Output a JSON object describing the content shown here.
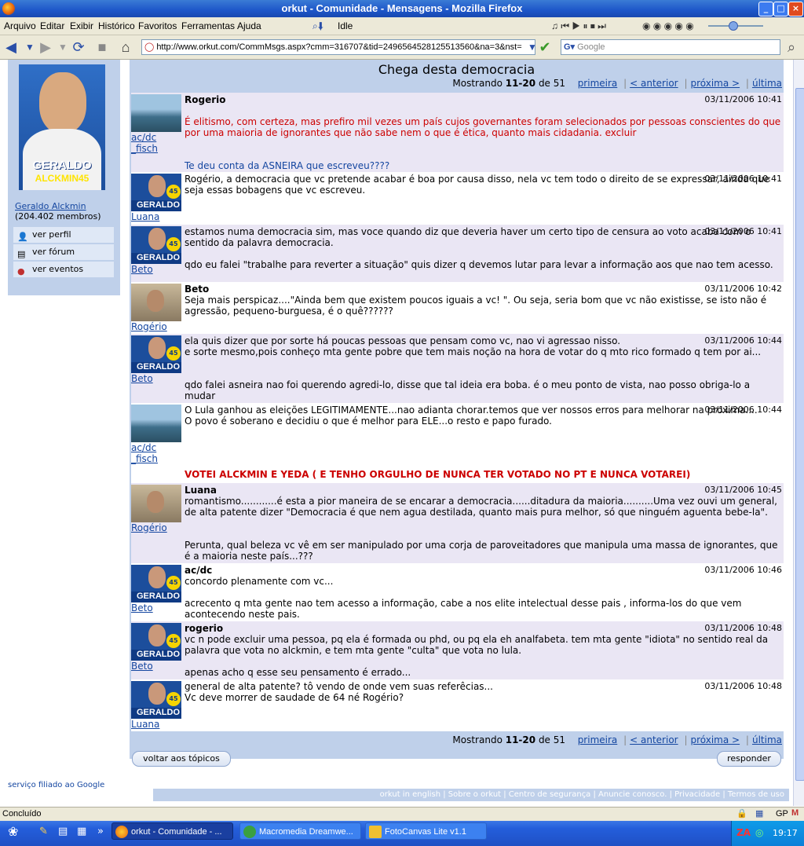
{
  "window": {
    "title": "orkut - Comunidade - Mensagens - Mozilla Firefox"
  },
  "menu": [
    "Arquivo",
    "Editar",
    "Exibir",
    "Histórico",
    "Favoritos",
    "Ferramentas",
    "Ajuda"
  ],
  "toolbar": {
    "idle_label": "Idle"
  },
  "address": {
    "url": "http://www.orkut.com/CommMsgs.aspx?cmm=316707&tid=2496564528125513560&na=3&nst=",
    "search_placeholder": "Google"
  },
  "left": {
    "profile_line1": "GERALDO",
    "profile_line2": "ALCKMIN45",
    "community_name": "Geraldo Alckmin",
    "members": "(204.402 membros)",
    "links": [
      {
        "label": "ver perfil"
      },
      {
        "label": "ver fórum"
      },
      {
        "label": "ver eventos"
      }
    ]
  },
  "topic": {
    "title": "Chega desta democracia",
    "pager": {
      "prefix": "Mostrando ",
      "range": "11-20",
      "of": " de 51",
      "first": "primeira",
      "prev": "< anterior",
      "next": "próxima >",
      "last": "última"
    }
  },
  "posts": [
    {
      "user": "ac/dc\n_fisch",
      "avatar": "sea",
      "author": "Rogerio",
      "date": "03/11/2006 10:41",
      "quote": "É elitismo, com certeza, mas prefiro mil vezes um país cujos governantes foram selecionados por pessoas conscientes do que por uma maioria de ignorantes que não sabe nem o que é ética, quanto mais cidadania. excluir",
      "text": "Te deu conta da ASNEIRA que escreveu????"
    },
    {
      "user": "Luana",
      "avatar": "gera",
      "author": "",
      "date": "03/11/2006 10:41",
      "text": "Rogério, a democracia que vc pretende acabar é boa por causa disso, nela vc tem todo o direito de se expressar, ainda que seja essas bobagens que vc escreveu."
    },
    {
      "user": "Beto",
      "avatar": "gera",
      "author": "",
      "date": "03/11/2006 10:41",
      "text": "estamos numa democracia sim, mas voce quando diz que deveria haver um certo tipo de censura ao voto acaba com o sentido da palavra democracia.",
      "text2": "qdo eu falei \"trabalhe para reverter a situação\" quis dizer q devemos lutar para levar a informação aos que nao tem acesso."
    },
    {
      "user": "Rogério",
      "avatar": "room",
      "author": "Beto",
      "date": "03/11/2006 10:42",
      "text": "Seja mais perspicaz....\"Ainda bem que existem poucos iguais a vc! \". Ou seja, seria bom que vc não existisse, se isto não é agressão, pequeno-burguesa, é o quê??????"
    },
    {
      "user": "Beto",
      "avatar": "gera",
      "author": "",
      "date": "03/11/2006 10:44",
      "text": "ela quis dizer que por sorte há poucas pessoas que pensam como vc, nao vi agressao nisso.\ne sorte mesmo,pois conheço mta gente pobre que tem mais noção na hora de votar do q mto rico formado q tem por ai...",
      "text2": "qdo falei asneira nao foi querendo agredi-lo, disse que tal ideia era boba. é o meu ponto de vista, nao posso obriga-lo a mudar"
    },
    {
      "user": "ac/dc\n_fisch",
      "avatar": "sea",
      "author": "",
      "date": "03/11/2006 10:44",
      "text": "O Lula ganhou as eleições LEGITIMAMENTE...nao adianta chorar.temos que ver nossos erros para melhorar na proxima....\nO povo é soberano e decidiu o que é melhor para ELE...o resto e papo furado.",
      "sig": "VOTEI ALCKMIN E YEDA ( E TENHO ORGULHO DE NUNCA TER VOTADO NO PT E NUNCA VOTAREI)"
    },
    {
      "user": "Rogério",
      "avatar": "room",
      "author": "Luana",
      "date": "03/11/2006 10:45",
      "text": "romantismo............é esta a pior maneira de se encarar a democracia......ditadura da maioria..........Uma vez ouvi um general, de alta patente dizer \"Democracia é que nem agua destilada, quanto mais pura melhor, só que ninguém aguenta bebe-la\".",
      "text2": "Perunta, qual beleza vc vê em ser manipulado por uma corja de paroveitadores que manipula uma massa de ignorantes, que é a maioria neste país...???"
    },
    {
      "user": "Beto",
      "avatar": "gera",
      "author": "ac/dc",
      "date": "03/11/2006 10:46",
      "text": "concordo plenamente com vc...",
      "text2": "acrecento q mta gente nao tem acesso a informação, cabe a nos elite intelectual desse pais , informa-los do que vem acontecendo neste pais."
    },
    {
      "user": "Beto",
      "avatar": "gera",
      "author": "rogerio",
      "date": "03/11/2006 10:48",
      "text": "vc n pode excluir uma pessoa, pq ela é formada ou phd, ou pq ela eh analfabeta. tem mta gente \"idiota\" no sentido real da palavra que vota no alckmin, e tem mta gente \"culta\" que vota no lula.",
      "text2": "apenas acho q esse seu pensamento é errado..."
    },
    {
      "user": "Luana",
      "avatar": "gera",
      "author": "",
      "date": "03/11/2006 10:48",
      "text": "general de alta patente? tô vendo de onde vem suas referêcias...\nVc deve morrer de saudade de 64 né Rogério?"
    }
  ],
  "buttons": {
    "back_topics": "voltar aos tópicos",
    "reply": "responder"
  },
  "footer": {
    "filiado": "serviço filiado ao Google",
    "links": "orkut in english  |  Sobre o orkut | Centro de segurança | Anuncie conosco. | Privacidade | Termos de uso"
  },
  "statusbar": {
    "text": "Concluído",
    "gp": "GP"
  },
  "taskbar": {
    "tasks": [
      {
        "label": "orkut - Comunidade - ..."
      },
      {
        "label": "Macromedia Dreamwe..."
      },
      {
        "label": "FotoCanvas Lite v1.1"
      }
    ],
    "clock": "19:17",
    "chevron": "»"
  },
  "avatar_badge": "GERALDO",
  "colors": {
    "blue": "#bfd0ea",
    "link": "#1446a0",
    "red": "#cc0000",
    "taskbar": "#245edb"
  }
}
